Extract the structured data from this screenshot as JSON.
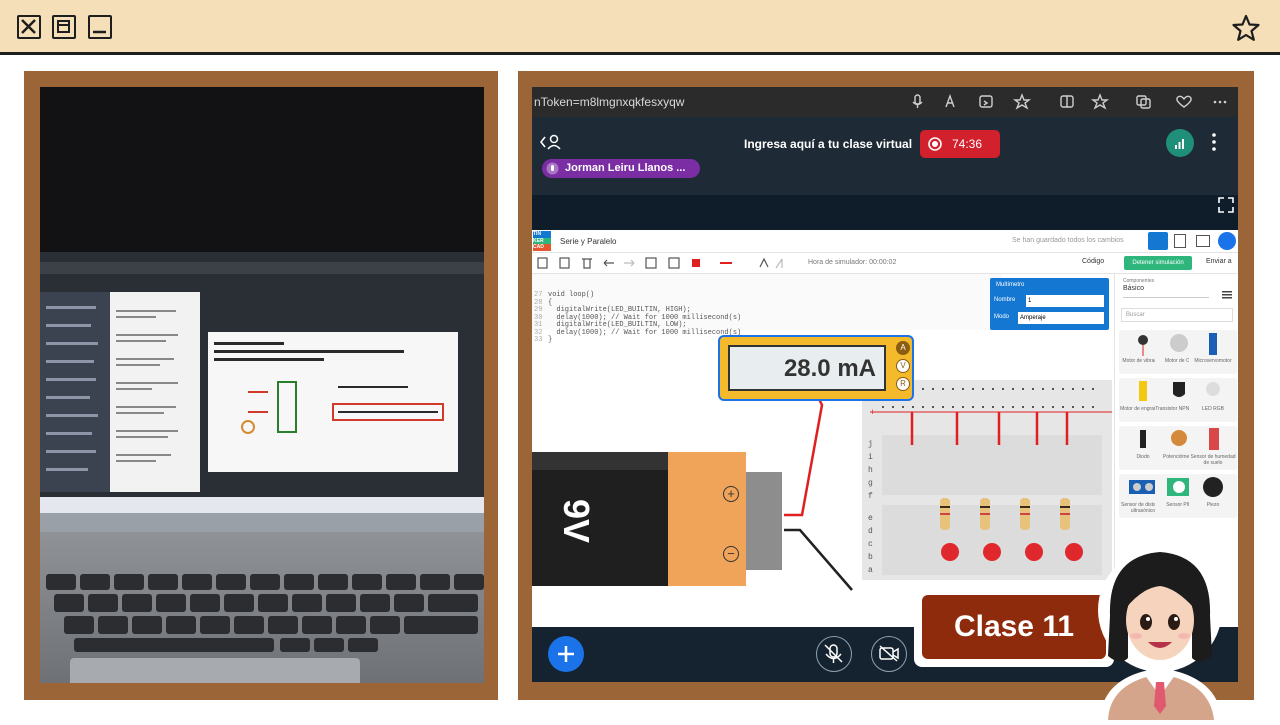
{
  "window": {
    "controls": [
      "close-icon",
      "maximize-icon",
      "minimize-icon"
    ],
    "favorite_icon": "star-icon",
    "colors": {
      "bar": "#f5dfb8",
      "frame": "#9c6538",
      "border": "#1e1e1e"
    }
  },
  "browser": {
    "url": "nToken=m8lmgnxqkfesxyqw",
    "icons": [
      "microphone-icon",
      "read-aloud-icon",
      "screen-share-icon",
      "favorite-icon",
      "split-screen-icon",
      "favorites-icon",
      "collections-icon",
      "health-icon",
      "more-icon"
    ]
  },
  "meeting": {
    "title": "Ingresa aquí a tu clase virtual",
    "record_time": "74:36",
    "speaker": "Jorman Leiru Llanos ...",
    "colors": {
      "record": "#d2202c",
      "speaker": "#7b2ea3",
      "signal": "#1f8f7a",
      "add": "#1a73e8"
    }
  },
  "tinkercad": {
    "logo": [
      "TIN",
      "KER",
      "CAD"
    ],
    "project_name": "Serie y Paralelo",
    "save_status": "Se han guardado todos los cambios",
    "sim_time": "Hora de simulador: 00:00:02",
    "code_label": "Código",
    "stop_label": "Detener simulación",
    "send_label": "Enviar a",
    "code_lines": [
      "void loop()",
      "{",
      "  digitalWrite(LED_BUILTIN, HIGH);",
      "  delay(1000); // Wait for 1000 millisecond(s)",
      "  digitalWrite(LED_BUILTIN, LOW);",
      "  delay(1000); // Wait for 1000 millisecond(s)",
      "}"
    ],
    "line_numbers": [
      "27",
      "28",
      "29",
      "30",
      "31",
      "32",
      "33"
    ],
    "multimeter_panel": {
      "title": "Multímetro",
      "name_label": "Nombre",
      "name_value": "1",
      "mode_label": "Modo",
      "mode_value": "Amperaje"
    },
    "meter_reading": "28.0 mA",
    "meter_modes": [
      "A",
      "V",
      "R"
    ],
    "battery_label": "9V",
    "battery_plus": "+",
    "battery_minus": "−",
    "breadboard_rows_top": [
      "j",
      "i",
      "h",
      "g",
      "f"
    ],
    "breadboard_rows_bottom": [
      "e",
      "d",
      "c",
      "b",
      "a"
    ],
    "components": {
      "header_label": "Componentes",
      "category": "Básico",
      "search_placeholder": "Buscar",
      "items": [
        "Motor de vibración",
        "Motor de CC",
        "Microservomotor",
        "Motor de engranajes",
        "Transistor NPN (BJT)",
        "LED RGB",
        "Diodo",
        "Potenciómetro",
        "Sensor de humedad de suelo",
        "Sensor de distancia ultrasónico",
        "Sensor PIR",
        "Piezo"
      ]
    }
  },
  "class_badge": {
    "label": "Clase 11",
    "color": "#8e2b0d"
  }
}
